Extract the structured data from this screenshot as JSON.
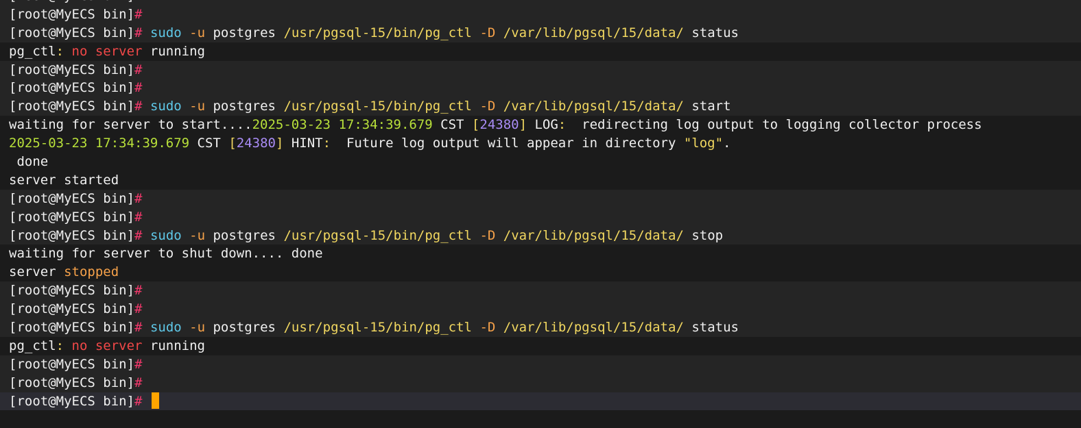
{
  "colors": {
    "white": "#f0f0f0",
    "pink": "#f2386b",
    "cyan": "#5fc8e8",
    "orange": "#f7a24a",
    "yellow": "#f2d860",
    "red": "#f24848",
    "green": "#b8e03a",
    "purple": "#a98cf5",
    "cursor": "#ffa500"
  },
  "lines": [
    {
      "kind": "prompt",
      "segs": [
        {
          "t": "[root@MyECS bin]",
          "c": "white"
        },
        {
          "t": "#",
          "c": "pink"
        }
      ]
    },
    {
      "kind": "prompt",
      "segs": [
        {
          "t": "[root@MyECS bin]",
          "c": "white"
        },
        {
          "t": "#",
          "c": "pink"
        }
      ]
    },
    {
      "kind": "prompt",
      "segs": [
        {
          "t": "[root@MyECS bin]",
          "c": "white"
        },
        {
          "t": "#",
          "c": "pink"
        },
        {
          "t": " ",
          "c": "white"
        },
        {
          "t": "sudo",
          "c": "cyan"
        },
        {
          "t": " ",
          "c": "white"
        },
        {
          "t": "-u",
          "c": "orange"
        },
        {
          "t": " postgres ",
          "c": "white"
        },
        {
          "t": "/usr/pgsql-15/bin/pg_ctl",
          "c": "yellow"
        },
        {
          "t": " ",
          "c": "white"
        },
        {
          "t": "-D",
          "c": "orange"
        },
        {
          "t": " ",
          "c": "white"
        },
        {
          "t": "/var/lib/pgsql/15/data/",
          "c": "yellow"
        },
        {
          "t": " status",
          "c": "white"
        }
      ]
    },
    {
      "kind": "output",
      "segs": [
        {
          "t": "pg_ctl",
          "c": "white"
        },
        {
          "t": ": ",
          "c": "yellow"
        },
        {
          "t": "no server",
          "c": "red"
        },
        {
          "t": " running",
          "c": "white"
        }
      ]
    },
    {
      "kind": "prompt",
      "segs": [
        {
          "t": "[root@MyECS bin]",
          "c": "white"
        },
        {
          "t": "#",
          "c": "pink"
        }
      ]
    },
    {
      "kind": "prompt",
      "segs": [
        {
          "t": "[root@MyECS bin]",
          "c": "white"
        },
        {
          "t": "#",
          "c": "pink"
        }
      ]
    },
    {
      "kind": "prompt",
      "segs": [
        {
          "t": "[root@MyECS bin]",
          "c": "white"
        },
        {
          "t": "#",
          "c": "pink"
        },
        {
          "t": " ",
          "c": "white"
        },
        {
          "t": "sudo",
          "c": "cyan"
        },
        {
          "t": " ",
          "c": "white"
        },
        {
          "t": "-u",
          "c": "orange"
        },
        {
          "t": " postgres ",
          "c": "white"
        },
        {
          "t": "/usr/pgsql-15/bin/pg_ctl",
          "c": "yellow"
        },
        {
          "t": " ",
          "c": "white"
        },
        {
          "t": "-D",
          "c": "orange"
        },
        {
          "t": " ",
          "c": "white"
        },
        {
          "t": "/var/lib/pgsql/15/data/",
          "c": "yellow"
        },
        {
          "t": " start",
          "c": "white"
        }
      ]
    },
    {
      "kind": "output",
      "segs": [
        {
          "t": "waiting for server to start....",
          "c": "white"
        },
        {
          "t": "2025-03-23 17:34:39.679",
          "c": "green"
        },
        {
          "t": " CST ",
          "c": "white"
        },
        {
          "t": "[",
          "c": "yellow"
        },
        {
          "t": "24380",
          "c": "purple"
        },
        {
          "t": "]",
          "c": "yellow"
        },
        {
          "t": " LOG",
          "c": "white"
        },
        {
          "t": ":",
          "c": "yellow"
        },
        {
          "t": "  redirecting log output to logging collector process",
          "c": "white"
        }
      ]
    },
    {
      "kind": "output",
      "segs": [
        {
          "t": "2025-03-23 17:34:39.679",
          "c": "green"
        },
        {
          "t": " CST ",
          "c": "white"
        },
        {
          "t": "[",
          "c": "yellow"
        },
        {
          "t": "24380",
          "c": "purple"
        },
        {
          "t": "]",
          "c": "yellow"
        },
        {
          "t": " HINT",
          "c": "white"
        },
        {
          "t": ":",
          "c": "yellow"
        },
        {
          "t": "  Future log output will appear in directory ",
          "c": "white"
        },
        {
          "t": "\"log\"",
          "c": "yellow"
        },
        {
          "t": ".",
          "c": "white"
        }
      ]
    },
    {
      "kind": "output",
      "segs": [
        {
          "t": " done",
          "c": "white"
        }
      ]
    },
    {
      "kind": "output",
      "segs": [
        {
          "t": "server started",
          "c": "white"
        }
      ]
    },
    {
      "kind": "prompt",
      "segs": [
        {
          "t": "[root@MyECS bin]",
          "c": "white"
        },
        {
          "t": "#",
          "c": "pink"
        }
      ]
    },
    {
      "kind": "prompt",
      "segs": [
        {
          "t": "[root@MyECS bin]",
          "c": "white"
        },
        {
          "t": "#",
          "c": "pink"
        }
      ]
    },
    {
      "kind": "prompt",
      "segs": [
        {
          "t": "[root@MyECS bin]",
          "c": "white"
        },
        {
          "t": "#",
          "c": "pink"
        },
        {
          "t": " ",
          "c": "white"
        },
        {
          "t": "sudo",
          "c": "cyan"
        },
        {
          "t": " ",
          "c": "white"
        },
        {
          "t": "-u",
          "c": "orange"
        },
        {
          "t": " postgres ",
          "c": "white"
        },
        {
          "t": "/usr/pgsql-15/bin/pg_ctl",
          "c": "yellow"
        },
        {
          "t": " ",
          "c": "white"
        },
        {
          "t": "-D",
          "c": "orange"
        },
        {
          "t": " ",
          "c": "white"
        },
        {
          "t": "/var/lib/pgsql/15/data/",
          "c": "yellow"
        },
        {
          "t": " stop",
          "c": "white"
        }
      ]
    },
    {
      "kind": "output",
      "segs": [
        {
          "t": "waiting for server to shut down.... done",
          "c": "white"
        }
      ]
    },
    {
      "kind": "output",
      "segs": [
        {
          "t": "server ",
          "c": "white"
        },
        {
          "t": "stopped",
          "c": "orange"
        }
      ]
    },
    {
      "kind": "prompt",
      "segs": [
        {
          "t": "[root@MyECS bin]",
          "c": "white"
        },
        {
          "t": "#",
          "c": "pink"
        }
      ]
    },
    {
      "kind": "prompt",
      "segs": [
        {
          "t": "[root@MyECS bin]",
          "c": "white"
        },
        {
          "t": "#",
          "c": "pink"
        }
      ]
    },
    {
      "kind": "prompt",
      "segs": [
        {
          "t": "[root@MyECS bin]",
          "c": "white"
        },
        {
          "t": "#",
          "c": "pink"
        },
        {
          "t": " ",
          "c": "white"
        },
        {
          "t": "sudo",
          "c": "cyan"
        },
        {
          "t": " ",
          "c": "white"
        },
        {
          "t": "-u",
          "c": "orange"
        },
        {
          "t": " postgres ",
          "c": "white"
        },
        {
          "t": "/usr/pgsql-15/bin/pg_ctl",
          "c": "yellow"
        },
        {
          "t": " ",
          "c": "white"
        },
        {
          "t": "-D",
          "c": "orange"
        },
        {
          "t": " ",
          "c": "white"
        },
        {
          "t": "/var/lib/pgsql/15/data/",
          "c": "yellow"
        },
        {
          "t": " status",
          "c": "white"
        }
      ]
    },
    {
      "kind": "output",
      "segs": [
        {
          "t": "pg_ctl",
          "c": "white"
        },
        {
          "t": ": ",
          "c": "yellow"
        },
        {
          "t": "no server",
          "c": "red"
        },
        {
          "t": " running",
          "c": "white"
        }
      ]
    },
    {
      "kind": "prompt",
      "segs": [
        {
          "t": "[root@MyECS bin]",
          "c": "white"
        },
        {
          "t": "#",
          "c": "pink"
        }
      ]
    },
    {
      "kind": "prompt",
      "segs": [
        {
          "t": "[root@MyECS bin]",
          "c": "white"
        },
        {
          "t": "#",
          "c": "pink"
        }
      ]
    },
    {
      "kind": "current",
      "segs": [
        {
          "t": "[root@MyECS bin]",
          "c": "white"
        },
        {
          "t": "#",
          "c": "pink"
        },
        {
          "t": " ",
          "c": "white"
        }
      ]
    }
  ]
}
